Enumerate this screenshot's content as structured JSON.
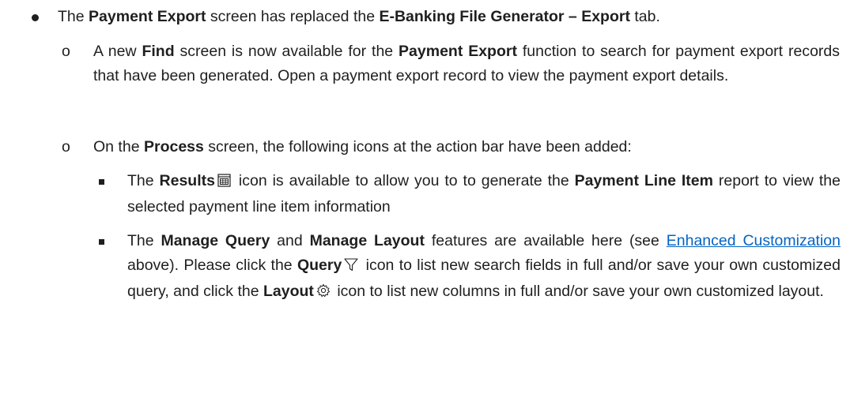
{
  "bullet": {
    "p1": "The ",
    "b1": "Payment Export",
    "p2": " screen has replaced the ",
    "b2": "E-Banking File Generator – Export",
    "p3": " tab."
  },
  "sub_marker": "o",
  "find": {
    "p1": "A new ",
    "b1": "Find",
    "p2": " screen is now available for the ",
    "b2": "Payment Export",
    "p3": " function to search for payment export records that have been generated. Open a payment export record to view the payment export details."
  },
  "process": {
    "p1": "On the ",
    "b1": "Process",
    "p2": " screen, the following icons at the action bar have been added:"
  },
  "results": {
    "p1": "The ",
    "b1": "Results",
    "icon": "results-grid-icon",
    "p2": " icon is available to allow you to to generate the ",
    "b2": "Payment Line Item",
    "p3": " report to view the selected payment line item information"
  },
  "manage": {
    "p1": "The ",
    "b1": "Manage Query",
    "p2": " and ",
    "b2": "Manage Layout",
    "p3": " features are available here (see ",
    "link": "Enhanced Customization",
    "p4": " above). Please click the ",
    "b3": "Query",
    "query_icon": "funnel-icon",
    "p5": " icon to list new search fields in full and/or save your own customized query, and click the ",
    "b4": "Layout",
    "layout_icon": "gear-icon",
    "p6": " icon to list new columns in full and/or save your own customized layout."
  },
  "colors": {
    "text": "#1f1f1f",
    "link": "#0563c1"
  }
}
